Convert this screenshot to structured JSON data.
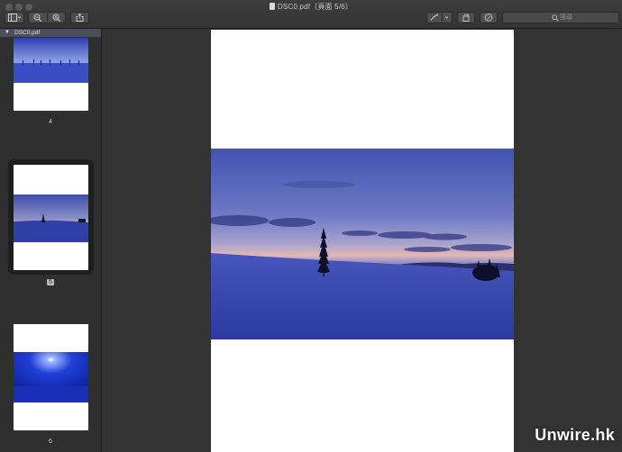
{
  "window": {
    "title": "DSC0.pdf（頁面 5/6）"
  },
  "toolbar": {
    "search_placeholder": "搜尋"
  },
  "sidebar": {
    "document_name": "DSC0.pdf",
    "pages": [
      {
        "number": "4"
      },
      {
        "number": "5",
        "selected": true
      },
      {
        "number": "6"
      }
    ]
  },
  "watermark": "Unwire.hk",
  "icons": {
    "sidebar_toggle": "sidebar-view-icon",
    "zoom_out": "zoom-out-icon",
    "zoom_in": "zoom-in-icon",
    "share": "share-icon",
    "markup": "pen-icon",
    "rotate": "rotate-icon",
    "annotate": "markup-circle-icon",
    "search": "search-icon"
  },
  "colors": {
    "window_bg": "#2b2b2b",
    "sidebar_header": "#4a4f5a",
    "page_bg": "#ffffff",
    "sky_blue": "#4a5bb0",
    "snow_blue": "#2f3ea0"
  }
}
